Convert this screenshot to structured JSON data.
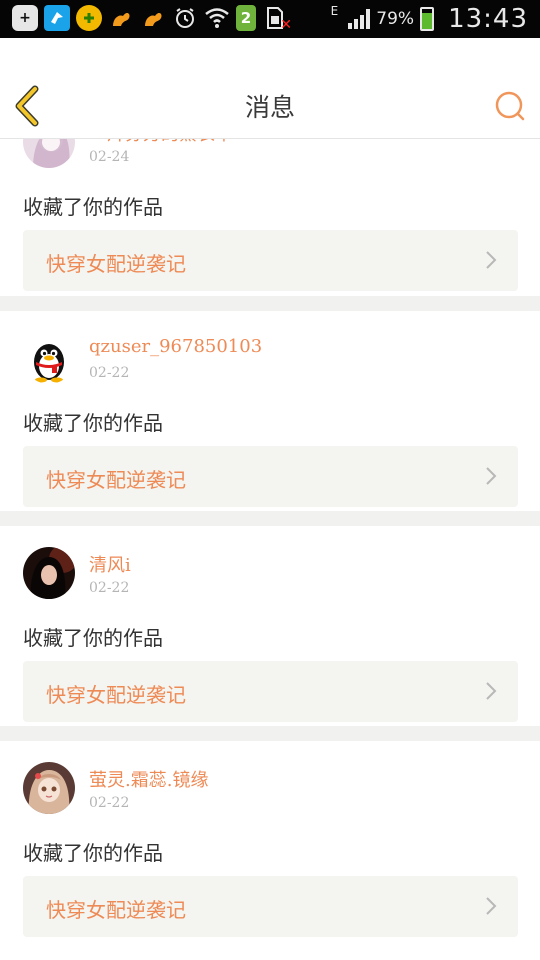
{
  "status_bar": {
    "network": "E",
    "battery": "79%",
    "time": "13:43",
    "sim_badge": "2",
    "icons": [
      "plus-icon",
      "bird-app-icon",
      "ball-app-icon",
      "squirrel-app-icon",
      "squirrel-app-icon",
      "alarm-icon",
      "wifi-icon",
      "sim-2-icon",
      "sim-error-icon",
      "signal-icon",
      "battery-icon"
    ]
  },
  "header": {
    "title": "消息",
    "back_icon": "chevron-left-icon",
    "search_icon": "search-icon"
  },
  "theme": {
    "accent": "#ee8a55",
    "back_color": "#f3c62a",
    "card_bg": "#f4f4f0",
    "divider": "#f1f1ef"
  },
  "messages": [
    {
      "user": "一片芬芳的薰衣草",
      "date": "02-24",
      "action": "收藏了你的作品",
      "work": "快穿女配逆袭记",
      "avatar": "anime-girl-avatar"
    },
    {
      "user": "qzuser_967850103",
      "date": "02-22",
      "action": "收藏了你的作品",
      "work": "快穿女配逆袭记",
      "avatar": "qq-penguin-avatar"
    },
    {
      "user": "清风i",
      "date": "02-22",
      "action": "收藏了你的作品",
      "work": "快穿女配逆袭记",
      "avatar": "portrait-photo-avatar"
    },
    {
      "user": "萤灵.霜蕊.镜缘",
      "date": "02-22",
      "action": "收藏了你的作品",
      "work": "快穿女配逆袭记",
      "avatar": "anime-doll-avatar"
    }
  ]
}
